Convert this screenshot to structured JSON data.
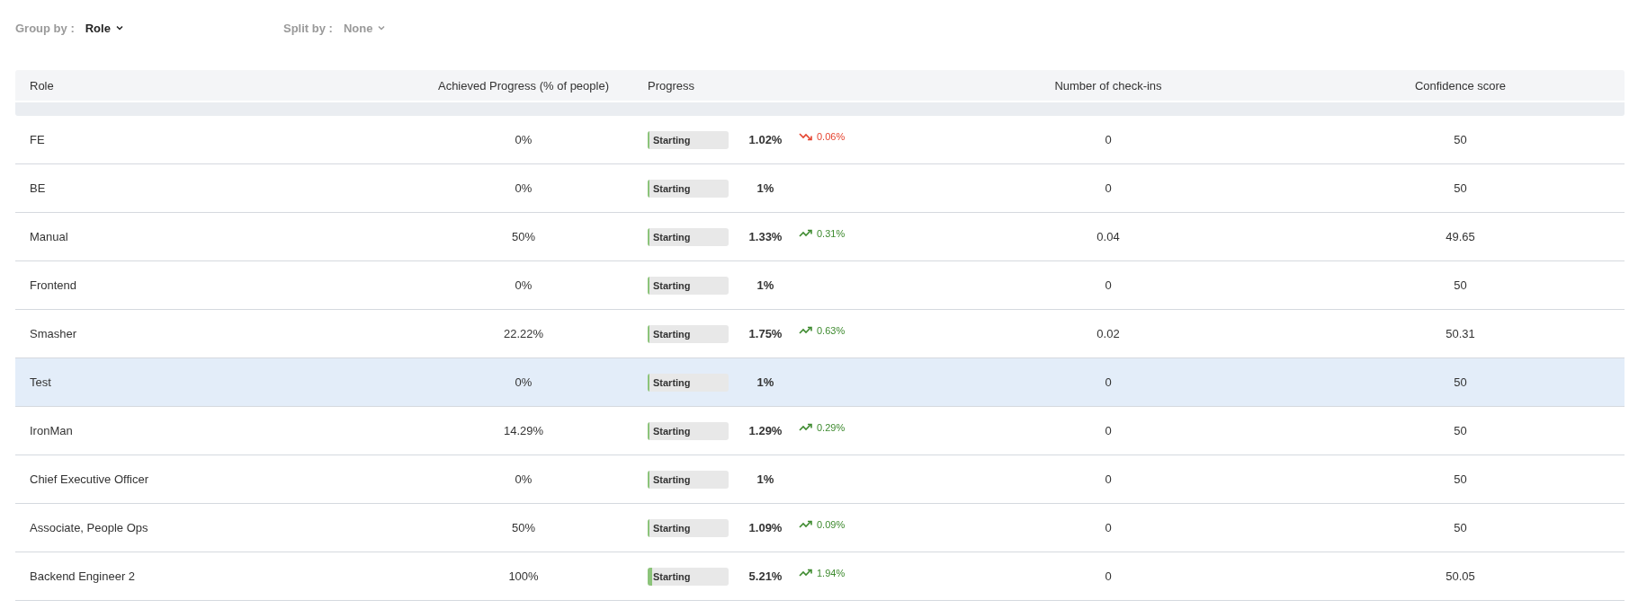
{
  "filters": [
    {
      "label": "Group by :",
      "value": "Role",
      "active": true
    },
    {
      "label": "Split by :",
      "value": "None",
      "active": false
    }
  ],
  "table": {
    "columns": [
      "Role",
      "Achieved Progress (% of people)",
      "Progress",
      "Number of check-ins",
      "Confidence score"
    ],
    "rows": [
      {
        "role": "FE",
        "achieved": "0%",
        "status": "Starting",
        "level": 0.0102,
        "progress": "1.02%",
        "trend": {
          "kind": "down",
          "value": "0.06%"
        },
        "checkins": "0",
        "confidence": "50",
        "selected": false
      },
      {
        "role": "BE",
        "achieved": "0%",
        "status": "Starting",
        "level": 0.01,
        "progress": "1%",
        "checkins": "0",
        "confidence": "50",
        "selected": false
      },
      {
        "role": "Manual",
        "achieved": "50%",
        "status": "Starting",
        "level": 0.0133,
        "progress": "1.33%",
        "trend": {
          "kind": "up",
          "value": "0.31%"
        },
        "checkins": "0.04",
        "confidence": "49.65",
        "selected": false
      },
      {
        "role": "Frontend",
        "achieved": "0%",
        "status": "Starting",
        "level": 0.01,
        "progress": "1%",
        "checkins": "0",
        "confidence": "50",
        "selected": false
      },
      {
        "role": "Smasher",
        "achieved": "22.22%",
        "status": "Starting",
        "level": 0.0175,
        "progress": "1.75%",
        "trend": {
          "kind": "up",
          "value": "0.63%"
        },
        "checkins": "0.02",
        "confidence": "50.31",
        "selected": false
      },
      {
        "role": "Test",
        "achieved": "0%",
        "status": "Starting",
        "level": 0.01,
        "progress": "1%",
        "checkins": "0",
        "confidence": "50",
        "selected": true
      },
      {
        "role": "IronMan",
        "achieved": "14.29%",
        "status": "Starting",
        "level": 0.0129,
        "progress": "1.29%",
        "trend": {
          "kind": "up",
          "value": "0.29%"
        },
        "checkins": "0",
        "confidence": "50",
        "selected": false
      },
      {
        "role": "Chief Executive Officer",
        "achieved": "0%",
        "status": "Starting",
        "level": 0.01,
        "progress": "1%",
        "checkins": "0",
        "confidence": "50",
        "selected": false
      },
      {
        "role": "Associate, People Ops",
        "achieved": "50%",
        "status": "Starting",
        "level": 0.0109,
        "progress": "1.09%",
        "trend": {
          "kind": "up",
          "value": "0.09%"
        },
        "checkins": "0",
        "confidence": "50",
        "selected": false
      },
      {
        "role": "Backend Engineer 2",
        "achieved": "100%",
        "status": "Starting",
        "level": 0.0521,
        "progress": "5.21%",
        "trend": {
          "kind": "up",
          "value": "1.94%"
        },
        "checkins": "0",
        "confidence": "50.05",
        "selected": false
      }
    ]
  }
}
